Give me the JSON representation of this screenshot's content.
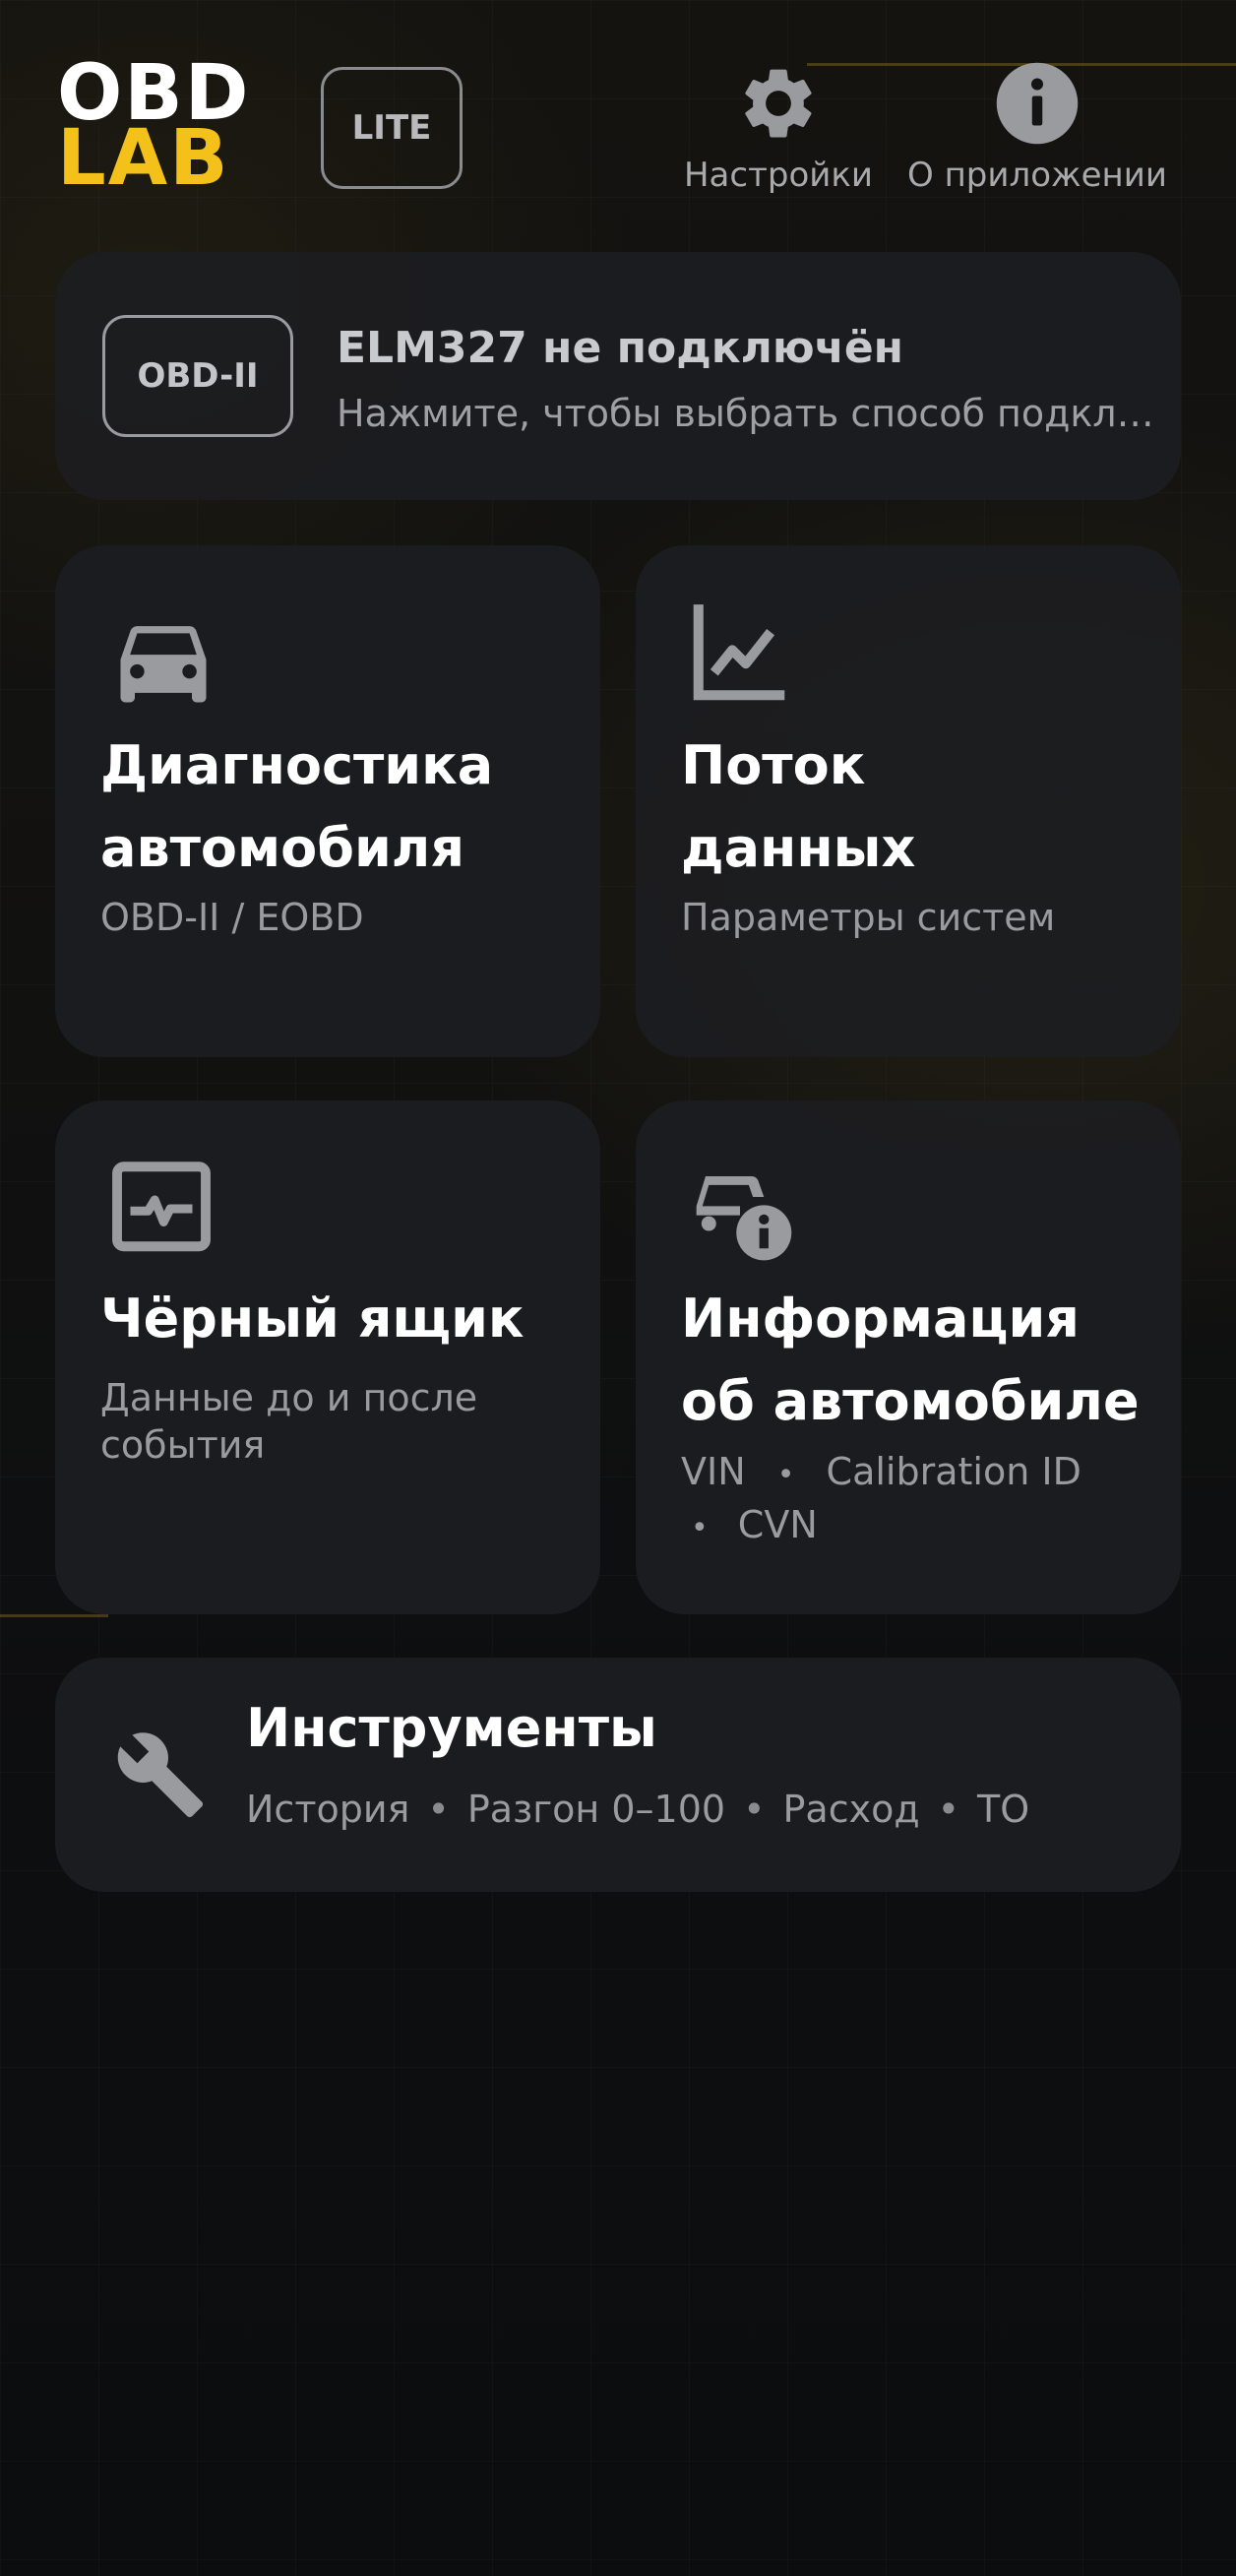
{
  "header": {
    "logo_line1": "OBD",
    "logo_line2": "LAB",
    "badge": "LITE",
    "settings_label": "Настройки",
    "about_label": "О приложении",
    "settings_icon": "gear-icon",
    "about_icon": "info-icon"
  },
  "connection": {
    "badge": "OBD-II",
    "title": "ELM327 не подключён",
    "subtitle": "Нажмите, чтобы выбрать способ подключения"
  },
  "tiles": [
    {
      "icon": "car-icon",
      "title_line1": "Диагностика",
      "title_line2": "автомобиля",
      "subtitle": "OBD-II / EOBD"
    },
    {
      "icon": "chart-line-icon",
      "title_line1": "Поток",
      "title_line2": "данных",
      "subtitle": "Параметры систем"
    },
    {
      "icon": "monitor-pulse-icon",
      "title_line1": "Чёрный ящик",
      "subtitle_line1": "Данные до и после",
      "subtitle_line2": "события"
    },
    {
      "icon": "car-info-icon",
      "title_line1": "Информация",
      "title_line2": "об автомобиле",
      "subtitle_parts": [
        "VIN",
        "Calibration ID",
        "CVN"
      ],
      "separator": "•"
    }
  ],
  "tools": {
    "icon": "wrench-icon",
    "title": "Инструменты",
    "items": [
      "История",
      "Разгон 0–100",
      "Расход",
      "ТО"
    ],
    "separator": "•"
  },
  "colors": {
    "background": "#0d0e10",
    "card": "#1c1d21",
    "accent_yellow": "#f3c11a",
    "icon_gray": "#9a9b9e",
    "text_primary": "#ffffff",
    "text_secondary": "#9a9b9e"
  }
}
